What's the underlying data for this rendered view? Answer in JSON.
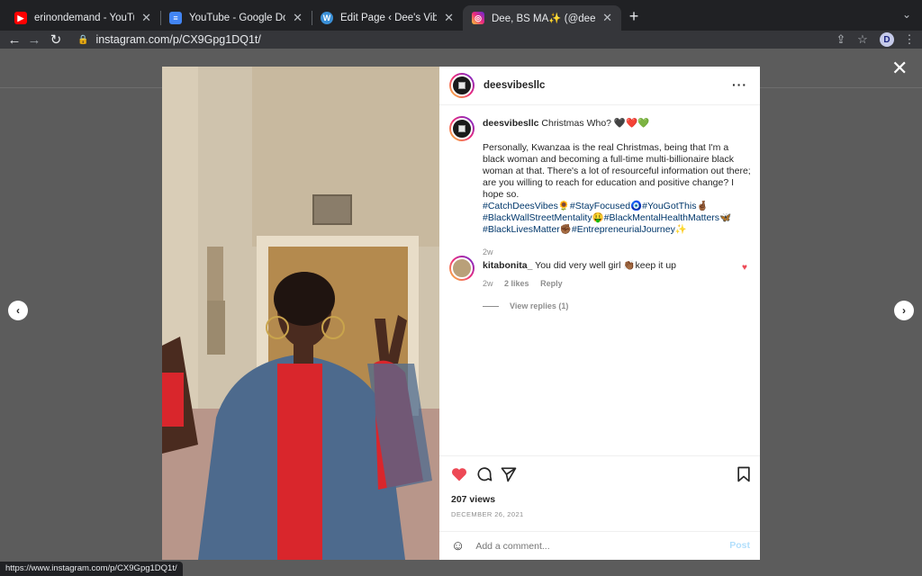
{
  "tabs": [
    {
      "title": "erinondemand - YouTube",
      "icon": "youtube-icon"
    },
    {
      "title": "YouTube - Google Docs",
      "icon": "docs-icon"
    },
    {
      "title": "Edit Page ‹ Dee's Vibes — Wor",
      "icon": "wordpress-icon"
    },
    {
      "title": "Dee, BS MA✨ (@deesvibesllc)",
      "icon": "instagram-icon"
    }
  ],
  "browser": {
    "url": "instagram.com/p/CX9Gpg1DQ1t/",
    "profile_initial": "D",
    "status_url": "https://www.instagram.com/p/CX9Gpg1DQ1t/"
  },
  "post": {
    "username": "deesvibesllc",
    "caption_user": "deesvibesllc",
    "caption_title": "Christmas Who? 🖤❤️💚",
    "caption_body": "Personally, Kwanzaa is the real Christmas, being that I'm a black woman and becoming a full-time multi-billionaire black woman at that. There's a lot of resourceful information out there; are you willing to reach for education and positive change? I hope so.",
    "hashtags_line1": "#CatchDeesVibes🌻#StayFocused🧿#YouGotThis🤞🏾",
    "hashtags_line2": "#BlackWallStreetMentality🤑#BlackMentalHealthMatters🦋",
    "hashtags_line3": "#BlackLivesMatter✊🏾#EntrepreneurialJourney✨",
    "caption_time": "2w",
    "comment": {
      "user": "kitabonita_",
      "text": "You did very well girl 👏🏾keep it up",
      "time": "2w",
      "likes": "2 likes",
      "reply": "Reply",
      "view_replies": "View replies (1)"
    },
    "views": "207 views",
    "date": "DECEMBER 26, 2021",
    "add_comment_placeholder": "Add a comment...",
    "post_label": "Post"
  },
  "colors": {
    "like_red": "#ed4956",
    "hashtag_blue": "#00376b",
    "post_disabled": "#b2dffc"
  }
}
